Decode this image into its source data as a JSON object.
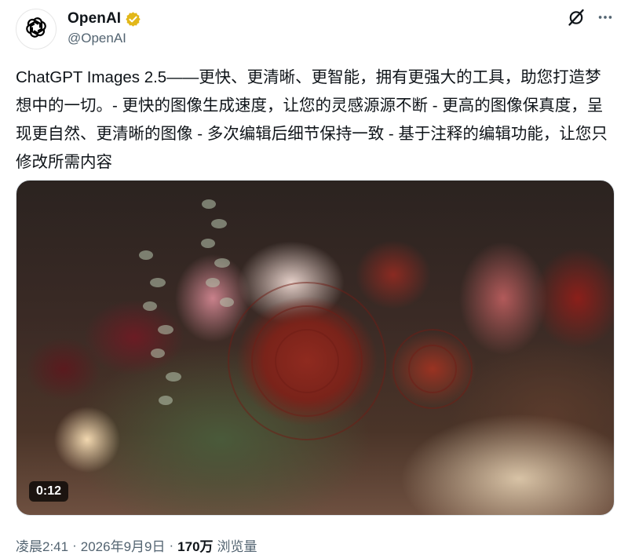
{
  "author": {
    "display_name": "OpenAI",
    "handle": "@OpenAI",
    "verified_color": "#e2b719",
    "avatar_icon": "openai-logo-icon"
  },
  "actions": {
    "grok_icon": "grok-icon",
    "more_icon": "more-icon"
  },
  "tweet": {
    "text": "ChatGPT Images 2.5——更快、更清晰、更智能，拥有更强大的工具，助您打造梦想中的一切。- 更快的图像生成速度，让您的灵感源源不断 - 更高的图像保真度，呈现更自然、更清晰的图像 - 多次编辑后细节保持一致 - 基于注释的编辑功能，让您只修改所需内容"
  },
  "media": {
    "type": "video",
    "duration": "0:12"
  },
  "meta": {
    "time": "凌晨2:41",
    "date": "2026年9月9日",
    "separator": "·",
    "views_count": "170万",
    "views_label": "浏览量"
  }
}
